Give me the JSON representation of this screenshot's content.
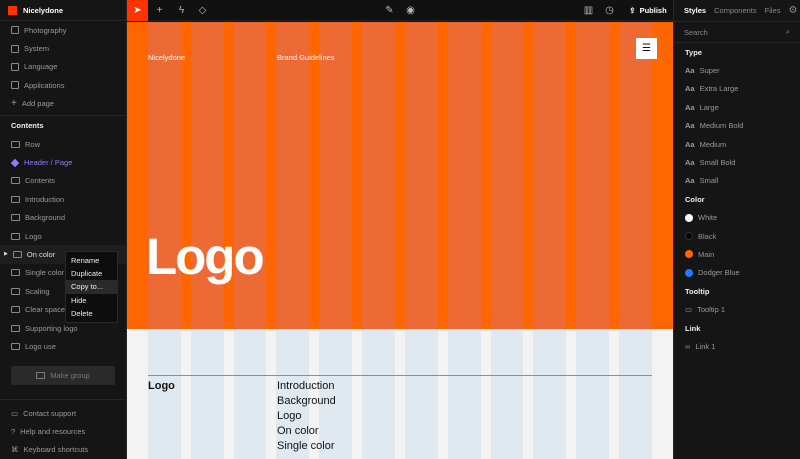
{
  "brand": "Nicelydone",
  "pages": [
    "Photography",
    "System",
    "Language",
    "Applications"
  ],
  "add_page": "Add page",
  "contents_title": "Contents",
  "contents": [
    "Row",
    "Header / Page",
    "Contents",
    "Introduction",
    "Background",
    "Logo",
    "On color",
    "Single color",
    "Scaling",
    "Clear space",
    "Supporting logo",
    "Logo use"
  ],
  "make_group": "Make group",
  "footer": [
    "Contact support",
    "Help and resources",
    "Keyboard shortcuts"
  ],
  "context_menu": [
    "Rename",
    "Duplicate",
    "Copy to...",
    "Hide",
    "Delete"
  ],
  "topbar": {
    "publish": "Publish"
  },
  "canvas": {
    "nav_brand": "Nicelydone",
    "nav_title": "Brand Guidelines",
    "logo": "Logo",
    "section_title": "Logo",
    "toc": [
      "Introduction",
      "Background",
      "Logo",
      "On color",
      "Single color"
    ]
  },
  "right": {
    "tabs": [
      "Styles",
      "Components",
      "Files"
    ],
    "search": "Search",
    "type_title": "Type",
    "types": [
      "Super",
      "Extra Large",
      "Large",
      "Medium Bold",
      "Medium",
      "Small Bold",
      "Small"
    ],
    "aa": "Aa",
    "color_title": "Color",
    "colors": [
      {
        "name": "White",
        "hex": "#ffffff"
      },
      {
        "name": "Black",
        "hex": "#000000"
      },
      {
        "name": "Main",
        "hex": "#ff6600"
      },
      {
        "name": "Dodger Blue",
        "hex": "#1e7bff"
      }
    ],
    "tooltip_title": "Tooltip",
    "tooltip": "Tooltip 1",
    "link_title": "Link",
    "link": "Link 1"
  }
}
